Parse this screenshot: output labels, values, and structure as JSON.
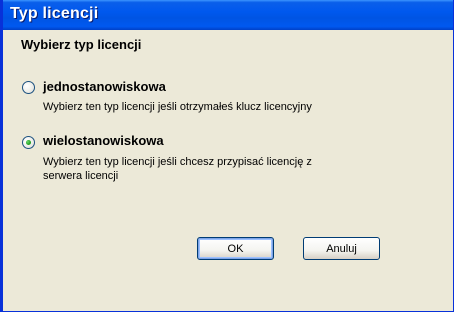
{
  "window": {
    "title": "Typ licencji"
  },
  "heading": "Wybierz typ licencji",
  "options": [
    {
      "label": "jednostanowiskowa",
      "description": "Wybierz ten typ licencji jeśli otrzymałeś klucz licencyjny",
      "selected": false
    },
    {
      "label": "wielostanowiskowa",
      "description_line1": "Wybierz ten typ licencji jeśli chcesz przypisać licencję z",
      "description_line2": "serwera licencji",
      "selected": true
    }
  ],
  "buttons": {
    "ok": "OK",
    "cancel": "Anuluj"
  },
  "colors": {
    "titlebar": "#0054e3",
    "dialog_bg": "#ece9d8",
    "radio_dot": "#21a121"
  }
}
